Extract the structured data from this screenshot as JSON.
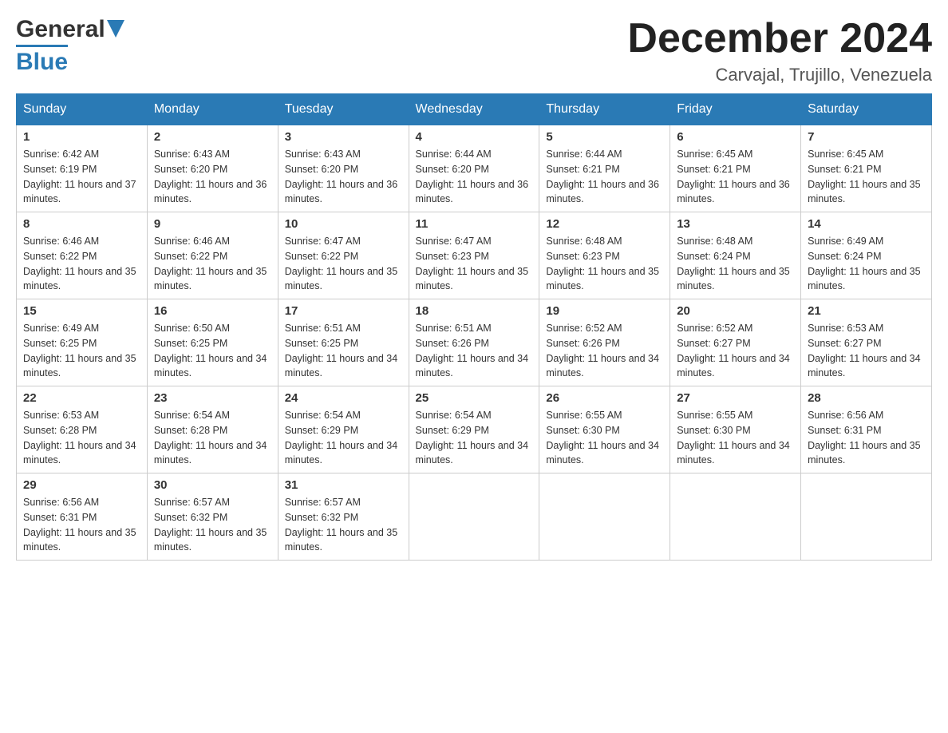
{
  "logo": {
    "general": "General",
    "blue": "Blue",
    "arrow": "▶"
  },
  "title": {
    "month": "December 2024",
    "location": "Carvajal, Trujillo, Venezuela"
  },
  "headers": [
    "Sunday",
    "Monday",
    "Tuesday",
    "Wednesday",
    "Thursday",
    "Friday",
    "Saturday"
  ],
  "weeks": [
    [
      {
        "day": "1",
        "sunrise": "Sunrise: 6:42 AM",
        "sunset": "Sunset: 6:19 PM",
        "daylight": "Daylight: 11 hours and 37 minutes."
      },
      {
        "day": "2",
        "sunrise": "Sunrise: 6:43 AM",
        "sunset": "Sunset: 6:20 PM",
        "daylight": "Daylight: 11 hours and 36 minutes."
      },
      {
        "day": "3",
        "sunrise": "Sunrise: 6:43 AM",
        "sunset": "Sunset: 6:20 PM",
        "daylight": "Daylight: 11 hours and 36 minutes."
      },
      {
        "day": "4",
        "sunrise": "Sunrise: 6:44 AM",
        "sunset": "Sunset: 6:20 PM",
        "daylight": "Daylight: 11 hours and 36 minutes."
      },
      {
        "day": "5",
        "sunrise": "Sunrise: 6:44 AM",
        "sunset": "Sunset: 6:21 PM",
        "daylight": "Daylight: 11 hours and 36 minutes."
      },
      {
        "day": "6",
        "sunrise": "Sunrise: 6:45 AM",
        "sunset": "Sunset: 6:21 PM",
        "daylight": "Daylight: 11 hours and 36 minutes."
      },
      {
        "day": "7",
        "sunrise": "Sunrise: 6:45 AM",
        "sunset": "Sunset: 6:21 PM",
        "daylight": "Daylight: 11 hours and 35 minutes."
      }
    ],
    [
      {
        "day": "8",
        "sunrise": "Sunrise: 6:46 AM",
        "sunset": "Sunset: 6:22 PM",
        "daylight": "Daylight: 11 hours and 35 minutes."
      },
      {
        "day": "9",
        "sunrise": "Sunrise: 6:46 AM",
        "sunset": "Sunset: 6:22 PM",
        "daylight": "Daylight: 11 hours and 35 minutes."
      },
      {
        "day": "10",
        "sunrise": "Sunrise: 6:47 AM",
        "sunset": "Sunset: 6:22 PM",
        "daylight": "Daylight: 11 hours and 35 minutes."
      },
      {
        "day": "11",
        "sunrise": "Sunrise: 6:47 AM",
        "sunset": "Sunset: 6:23 PM",
        "daylight": "Daylight: 11 hours and 35 minutes."
      },
      {
        "day": "12",
        "sunrise": "Sunrise: 6:48 AM",
        "sunset": "Sunset: 6:23 PM",
        "daylight": "Daylight: 11 hours and 35 minutes."
      },
      {
        "day": "13",
        "sunrise": "Sunrise: 6:48 AM",
        "sunset": "Sunset: 6:24 PM",
        "daylight": "Daylight: 11 hours and 35 minutes."
      },
      {
        "day": "14",
        "sunrise": "Sunrise: 6:49 AM",
        "sunset": "Sunset: 6:24 PM",
        "daylight": "Daylight: 11 hours and 35 minutes."
      }
    ],
    [
      {
        "day": "15",
        "sunrise": "Sunrise: 6:49 AM",
        "sunset": "Sunset: 6:25 PM",
        "daylight": "Daylight: 11 hours and 35 minutes."
      },
      {
        "day": "16",
        "sunrise": "Sunrise: 6:50 AM",
        "sunset": "Sunset: 6:25 PM",
        "daylight": "Daylight: 11 hours and 34 minutes."
      },
      {
        "day": "17",
        "sunrise": "Sunrise: 6:51 AM",
        "sunset": "Sunset: 6:25 PM",
        "daylight": "Daylight: 11 hours and 34 minutes."
      },
      {
        "day": "18",
        "sunrise": "Sunrise: 6:51 AM",
        "sunset": "Sunset: 6:26 PM",
        "daylight": "Daylight: 11 hours and 34 minutes."
      },
      {
        "day": "19",
        "sunrise": "Sunrise: 6:52 AM",
        "sunset": "Sunset: 6:26 PM",
        "daylight": "Daylight: 11 hours and 34 minutes."
      },
      {
        "day": "20",
        "sunrise": "Sunrise: 6:52 AM",
        "sunset": "Sunset: 6:27 PM",
        "daylight": "Daylight: 11 hours and 34 minutes."
      },
      {
        "day": "21",
        "sunrise": "Sunrise: 6:53 AM",
        "sunset": "Sunset: 6:27 PM",
        "daylight": "Daylight: 11 hours and 34 minutes."
      }
    ],
    [
      {
        "day": "22",
        "sunrise": "Sunrise: 6:53 AM",
        "sunset": "Sunset: 6:28 PM",
        "daylight": "Daylight: 11 hours and 34 minutes."
      },
      {
        "day": "23",
        "sunrise": "Sunrise: 6:54 AM",
        "sunset": "Sunset: 6:28 PM",
        "daylight": "Daylight: 11 hours and 34 minutes."
      },
      {
        "day": "24",
        "sunrise": "Sunrise: 6:54 AM",
        "sunset": "Sunset: 6:29 PM",
        "daylight": "Daylight: 11 hours and 34 minutes."
      },
      {
        "day": "25",
        "sunrise": "Sunrise: 6:54 AM",
        "sunset": "Sunset: 6:29 PM",
        "daylight": "Daylight: 11 hours and 34 minutes."
      },
      {
        "day": "26",
        "sunrise": "Sunrise: 6:55 AM",
        "sunset": "Sunset: 6:30 PM",
        "daylight": "Daylight: 11 hours and 34 minutes."
      },
      {
        "day": "27",
        "sunrise": "Sunrise: 6:55 AM",
        "sunset": "Sunset: 6:30 PM",
        "daylight": "Daylight: 11 hours and 34 minutes."
      },
      {
        "day": "28",
        "sunrise": "Sunrise: 6:56 AM",
        "sunset": "Sunset: 6:31 PM",
        "daylight": "Daylight: 11 hours and 35 minutes."
      }
    ],
    [
      {
        "day": "29",
        "sunrise": "Sunrise: 6:56 AM",
        "sunset": "Sunset: 6:31 PM",
        "daylight": "Daylight: 11 hours and 35 minutes."
      },
      {
        "day": "30",
        "sunrise": "Sunrise: 6:57 AM",
        "sunset": "Sunset: 6:32 PM",
        "daylight": "Daylight: 11 hours and 35 minutes."
      },
      {
        "day": "31",
        "sunrise": "Sunrise: 6:57 AM",
        "sunset": "Sunset: 6:32 PM",
        "daylight": "Daylight: 11 hours and 35 minutes."
      },
      null,
      null,
      null,
      null
    ]
  ]
}
